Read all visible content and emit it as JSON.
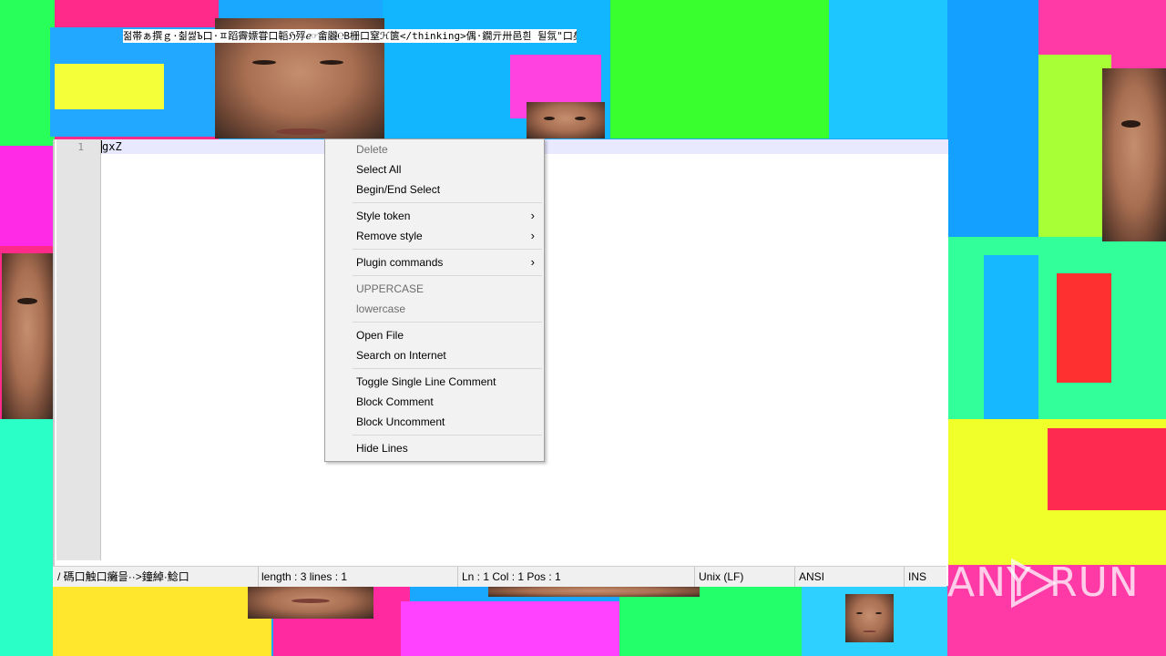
{
  "background": {
    "title_garbage": "젊帯ぁ撰ｇ·췲썷Ъ口·ㅍ蹈霽嫖甞口韜ℌ殍ℯ☞畲龖℮B栅口窒ℋ篋</thinking>偶·鐗亓卅邑흰  뒬氛\"口矣乱ˢ˙"
  },
  "editor": {
    "line_numbers": [
      "1"
    ],
    "lines": [
      "gxZ"
    ]
  },
  "status_bar": {
    "file_type": "/ 碼口触口癱믈··>鐘綽·鯰口",
    "length_lines": "length : 3    lines : 1",
    "position": "Ln : 1    Col : 1    Pos : 1",
    "eol": "Unix (LF)",
    "encoding": "ANSI",
    "insert_mode": "INS"
  },
  "context_menu": {
    "delete": "Delete",
    "select_all": "Select All",
    "begin_end_select": "Begin/End Select",
    "style_token": "Style token",
    "remove_style": "Remove style",
    "plugin_commands": "Plugin commands",
    "uppercase": "UPPERCASE",
    "lowercase": "lowercase",
    "open_file": "Open File",
    "search_internet": "Search on Internet",
    "toggle_comment": "Toggle Single Line Comment",
    "block_comment": "Block Comment",
    "block_uncomment": "Block Uncomment",
    "hide_lines": "Hide Lines",
    "submenu_arrow": "›"
  },
  "watermark": {
    "text_left": "ANY",
    "text_right": "RUN"
  },
  "colors": {
    "menu_bg": "#f2f2f2",
    "disabled_text": "#6d6d6d",
    "current_line": "#e8e8ff"
  }
}
